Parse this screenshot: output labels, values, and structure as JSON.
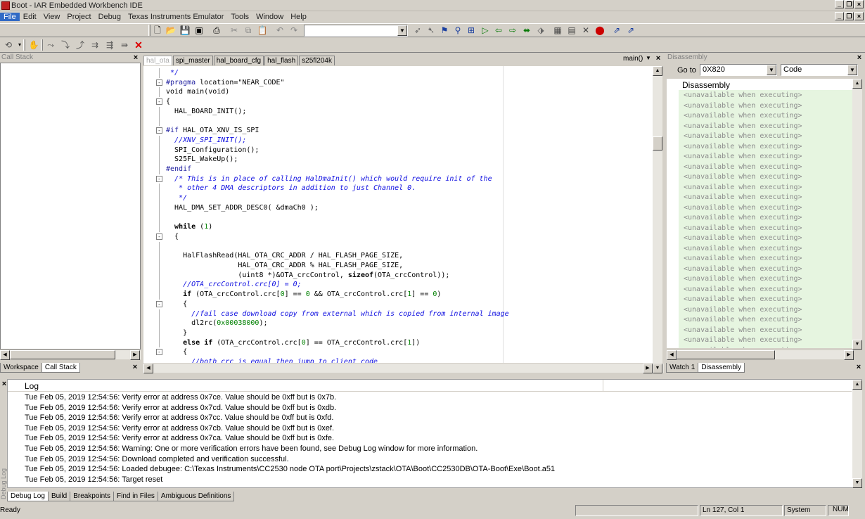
{
  "window": {
    "title": "Boot - IAR Embedded Workbench IDE"
  },
  "menu": [
    "File",
    "Edit",
    "View",
    "Project",
    "Debug",
    "Texas Instruments Emulator",
    "Tools",
    "Window",
    "Help"
  ],
  "toolbar": {
    "search_value": ""
  },
  "call_stack": {
    "title": "Call Stack"
  },
  "left_tabs": [
    "Workspace",
    "Call Stack"
  ],
  "editor": {
    "tabs": [
      "hal_ota",
      "spi_master",
      "hal_board_cfg",
      "hal_flash",
      "s25fl204k"
    ],
    "function_label": "main()",
    "lines": [
      {
        "text": " */",
        "cls": "cm"
      },
      {
        "html": "<span class=\"pp\">#pragma</span> location=\"NEAR_CODE\""
      },
      {
        "html": "void main(void)"
      },
      {
        "html": "{"
      },
      {
        "html": "  HAL_BOARD_INIT();"
      },
      {
        "html": ""
      },
      {
        "html": "<span class=\"pp\">#if</span> HAL_OTA_XNV_IS_SPI"
      },
      {
        "html": "  <span class=\"cm\">//XNV_SPI_INIT();</span>"
      },
      {
        "html": "  SPI_Configuration();"
      },
      {
        "html": "  S25FL_WakeUp();"
      },
      {
        "html": "<span class=\"pp\">#endif</span>"
      },
      {
        "html": "  <span class=\"cm\">/* This is in place of calling HalDmaInit() which would require init of the</span>"
      },
      {
        "html": "<span class=\"cm\">   * other 4 DMA descriptors in addition to just Channel 0.</span>"
      },
      {
        "html": "<span class=\"cm\">   */</span>"
      },
      {
        "html": "  HAL_DMA_SET_ADDR_DESC0( &amp;dmaCh0 );"
      },
      {
        "html": ""
      },
      {
        "html": "  <span class=\"kw\">while</span> (<span class=\"num\">1</span>)"
      },
      {
        "html": "  {"
      },
      {
        "html": ""
      },
      {
        "html": "    HalFlashRead(HAL_OTA_CRC_ADDR / HAL_FLASH_PAGE_SIZE,"
      },
      {
        "html": "                 HAL_OTA_CRC_ADDR % HAL_FLASH_PAGE_SIZE,"
      },
      {
        "html": "                 (uint8 *)&amp;OTA_crcControl, <span class=\"kw\">sizeof</span>(OTA_crcControl));"
      },
      {
        "html": "    <span class=\"cm\">//OTA_crcControl.crc[0] = 0;</span>"
      },
      {
        "html": "    <span class=\"kw\">if</span> (OTA_crcControl.crc[<span class=\"num\">0</span>] == <span class=\"num\">0</span> &amp;&amp; OTA_crcControl.crc[<span class=\"num\">1</span>] == <span class=\"num\">0</span>)"
      },
      {
        "html": "    {"
      },
      {
        "html": "      <span class=\"cm\">//fail case download copy from external which is copied from internal image</span>"
      },
      {
        "html": "      dl2rc(<span class=\"num\">0x00038000</span>);"
      },
      {
        "html": "    }"
      },
      {
        "html": "    <span class=\"kw\">else if</span> (OTA_crcControl.crc[<span class=\"num\">0</span>] == OTA_crcControl.crc[<span class=\"num\">1</span>])"
      },
      {
        "html": "    {"
      },
      {
        "html": "      <span class=\"cm\">//both crc is equal then jump to client code</span>"
      }
    ]
  },
  "disassembly": {
    "title": "Disassembly",
    "goto_label": "Go to",
    "goto_value": "0X820",
    "memory_type": "Code",
    "header": "Disassembly",
    "line_text": "<unavailable when executing>",
    "line_count": 26
  },
  "right_tabs": [
    "Watch 1",
    "Disassembly"
  ],
  "log": {
    "header": "Log",
    "side_label": "Debug Log",
    "entries": [
      "Tue Feb 05, 2019 12:54:56: Verify error at address 0x7ce. Value should be 0xff  but is 0x7b.",
      "Tue Feb 05, 2019 12:54:56: Verify error at address 0x7cd. Value should be 0xff  but is 0xdb.",
      "Tue Feb 05, 2019 12:54:56: Verify error at address 0x7cc. Value should be 0xff  but is 0xfd.",
      "Tue Feb 05, 2019 12:54:56: Verify error at address 0x7cb. Value should be 0xff  but is 0xef.",
      "Tue Feb 05, 2019 12:54:56: Verify error at address 0x7ca. Value should be 0xff  but is 0xfe.",
      "Tue Feb 05, 2019 12:54:56: Warning: One or more verification errors have been found, see Debug Log window for more information.",
      "Tue Feb 05, 2019 12:54:56: Download completed and verification successful.",
      "Tue Feb 05, 2019 12:54:56: Loaded debugee: C:\\Texas Instruments\\CC2530  node OTA port\\Projects\\zstack\\OTA\\Boot\\CC2530DB\\OTA-Boot\\Exe\\Boot.a51",
      "Tue Feb 05, 2019 12:54:56: Target reset"
    ]
  },
  "bottom_tabs": [
    "Debug Log",
    "Build",
    "Breakpoints",
    "Find in Files",
    "Ambiguous Definitions"
  ],
  "status": {
    "ready": "Ready",
    "position": "Ln 127, Col 1",
    "system": "System",
    "num": "NUM"
  }
}
